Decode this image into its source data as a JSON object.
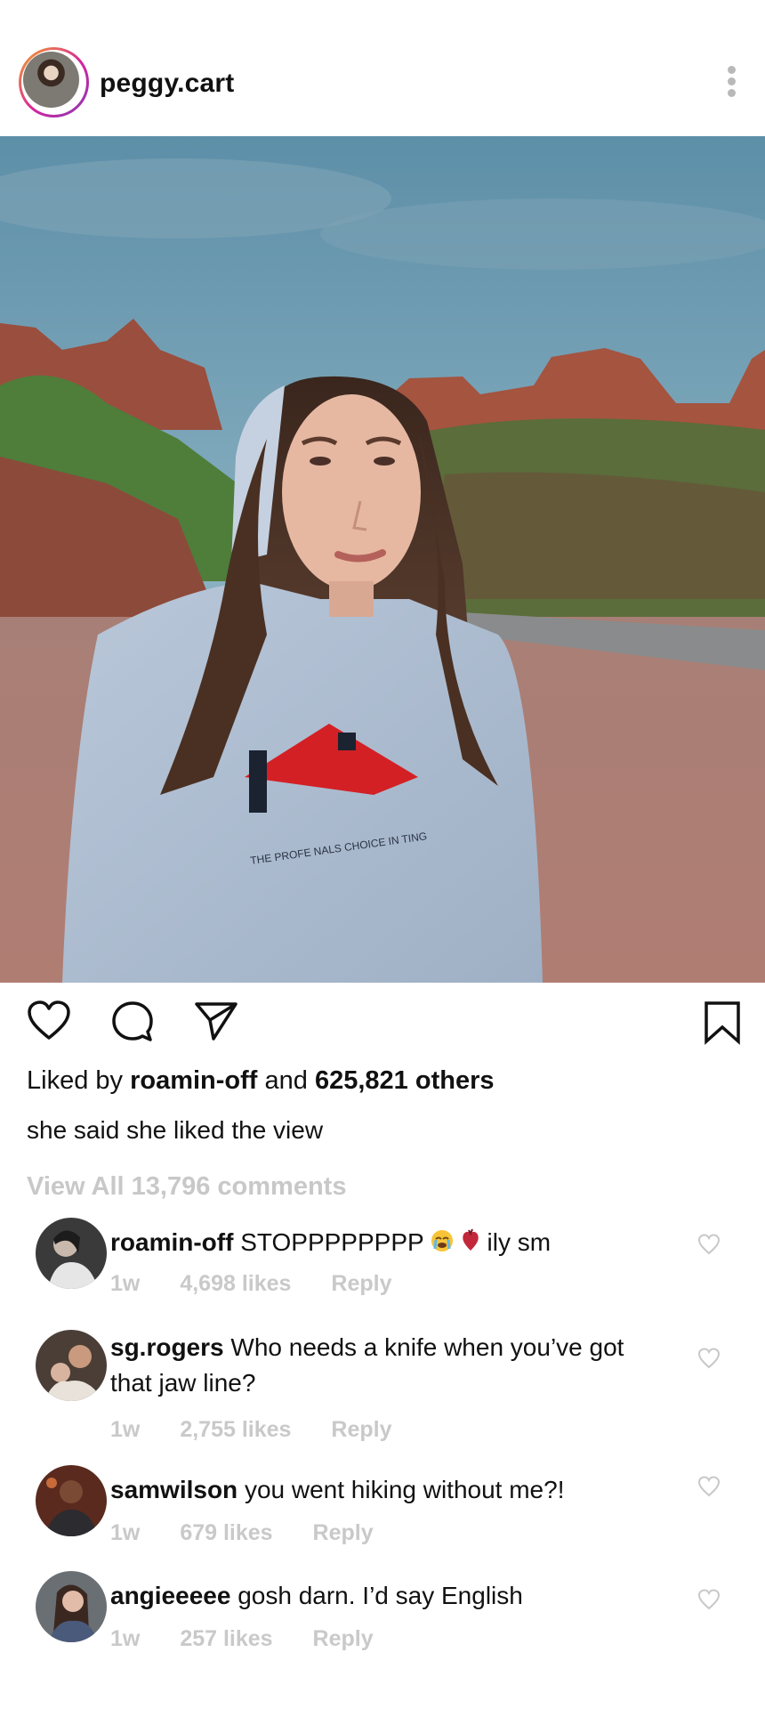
{
  "post": {
    "username": "peggy.cart",
    "likes_prefix": "Liked by",
    "likes_user": "roamin-off",
    "likes_and": "and",
    "likes_count": "625,821 others",
    "caption": "she said she liked the view",
    "view_all": "View All 13,796 comments",
    "photo_shirt_text": "THE PROFE    NALS CHOICE IN   TING"
  },
  "comments": [
    {
      "user": "roamin-off",
      "text": "STOPPPPPPPP",
      "after_emoji": "ily sm",
      "time": "1w",
      "likes": "4,698 likes",
      "reply": "Reply"
    },
    {
      "user": "sg.rogers",
      "text": "Who needs a knife when you’ve got that jaw line?",
      "time": "1w",
      "likes": "2,755 likes",
      "reply": "Reply"
    },
    {
      "user": "samwilson",
      "text": "you went hiking without me?!",
      "time": "1w",
      "likes": "679 likes",
      "reply": "Reply"
    },
    {
      "user": "angieeeee",
      "text": "gosh darn. I’d say English",
      "time": "1w",
      "likes": "257 likes",
      "reply": "Reply"
    }
  ],
  "colors": {
    "ring_start": "#f5a623",
    "ring_end": "#833ab4",
    "muted": "#c8c8c8"
  },
  "icons": [
    "more-dots-icon",
    "heart-icon",
    "comment-icon",
    "share-icon",
    "bookmark-icon",
    "emoji-crying-icon",
    "emoji-heart-icon"
  ]
}
